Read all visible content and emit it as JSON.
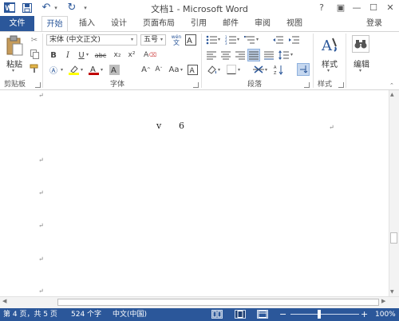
{
  "app": {
    "title": "文档1 - Microsoft Word",
    "help": "?",
    "window_controls": [
      "—",
      "☐",
      "✕"
    ]
  },
  "quick_access": [
    {
      "name": "word-logo-icon",
      "glyph": "W"
    },
    {
      "name": "save-icon",
      "glyph": "💾"
    },
    {
      "name": "undo-icon",
      "glyph": "↶"
    },
    {
      "name": "redo-icon",
      "glyph": "↻"
    }
  ],
  "tabs": {
    "file": "文件",
    "items": [
      "开始",
      "插入",
      "设计",
      "页面布局",
      "引用",
      "邮件",
      "审阅",
      "视图"
    ],
    "active": "开始",
    "login": "登录"
  },
  "ribbon": {
    "clipboard": {
      "label": "剪贴板",
      "paste": "粘贴"
    },
    "font": {
      "label": "字体",
      "font_name": "宋体 (中文正文)",
      "font_size": "五号",
      "buttons": [
        "B",
        "I",
        "U",
        "abc",
        "x₂",
        "x²"
      ]
    },
    "paragraph": {
      "label": "段落"
    },
    "styles": {
      "label": "样式",
      "button": "样式"
    },
    "editing": {
      "button": "编辑"
    }
  },
  "document": {
    "formula": [
      "v",
      "6"
    ],
    "paragraph_mark": "↵"
  },
  "status": {
    "page": "第 4 页，共 5 页",
    "words": "524 个字",
    "language": "中文(中国)",
    "zoom": "100%",
    "zoom_minus": "−",
    "zoom_plus": "+"
  },
  "colors": {
    "accent": "#2b579a",
    "font_color": "#c00000",
    "highlight": "#ffff00"
  }
}
